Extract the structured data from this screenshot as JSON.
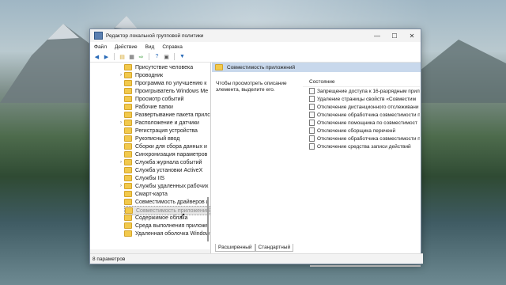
{
  "window": {
    "title": "Редактор локальной групповой политики",
    "controls": {
      "minimize": "—",
      "maximize": "☐",
      "close": "✕"
    }
  },
  "menu": [
    "Файл",
    "Действие",
    "Вид",
    "Справка"
  ],
  "toolbar_icons": [
    "back-arrow-icon",
    "forward-arrow-icon",
    "folder-up-icon",
    "show-hide-tree-icon",
    "export-icon",
    "help-icon",
    "properties-icon",
    "filter-icon"
  ],
  "tree": [
    {
      "label": "Присутствие человека",
      "expandable": false
    },
    {
      "label": "Проводник",
      "expandable": true
    },
    {
      "label": "Программа по улучшению к",
      "expandable": false
    },
    {
      "label": "Проигрыватель Windows Me",
      "expandable": false
    },
    {
      "label": "Просмотр событий",
      "expandable": false
    },
    {
      "label": "Рабочие папки",
      "expandable": false
    },
    {
      "label": "Развертывание пакета прилс",
      "expandable": false
    },
    {
      "label": "Расположение и датчики",
      "expandable": true
    },
    {
      "label": "Регистрация устройства",
      "expandable": false
    },
    {
      "label": "Рукописный ввод",
      "expandable": false
    },
    {
      "label": "Сборки для сбора данных и",
      "expandable": false
    },
    {
      "label": "Синхронизация параметров",
      "expandable": false
    },
    {
      "label": "Служба журнала событий",
      "expandable": true
    },
    {
      "label": "Служба установки ActiveX",
      "expandable": false
    },
    {
      "label": "Службы IIS",
      "expandable": false
    },
    {
      "label": "Службы удаленных рабочих",
      "expandable": true
    },
    {
      "label": "Смарт-карта",
      "expandable": false
    },
    {
      "label": "Совместимость драйверов и",
      "expandable": false
    },
    {
      "label": "Совместимость приложений",
      "expandable": false,
      "selected": true
    },
    {
      "label": "Содержимое облака",
      "expandable": false
    },
    {
      "label": "Среда выполнения приложе",
      "expandable": false
    },
    {
      "label": "Удаленная оболочка Window",
      "expandable": false
    }
  ],
  "right": {
    "header": "Совместимость приложений",
    "description": "Чтобы просмотреть описание элемента, выделите его.",
    "column": "Состояние",
    "policies": [
      "Запрещение доступа к 16-разрядным прил",
      "Удаление страницы свойств «Совместим",
      "Отключение дистанционного отслеживани",
      "Отключение обработчика совместимости п",
      "Отключение помощника по совместимост",
      "Отключение сборщика переченй",
      "Отключение обработчика совместимости п",
      "Отключение средства записи действий"
    ]
  },
  "tabs": [
    "Расширенный",
    "Стандартный"
  ],
  "status": "8 параметров"
}
